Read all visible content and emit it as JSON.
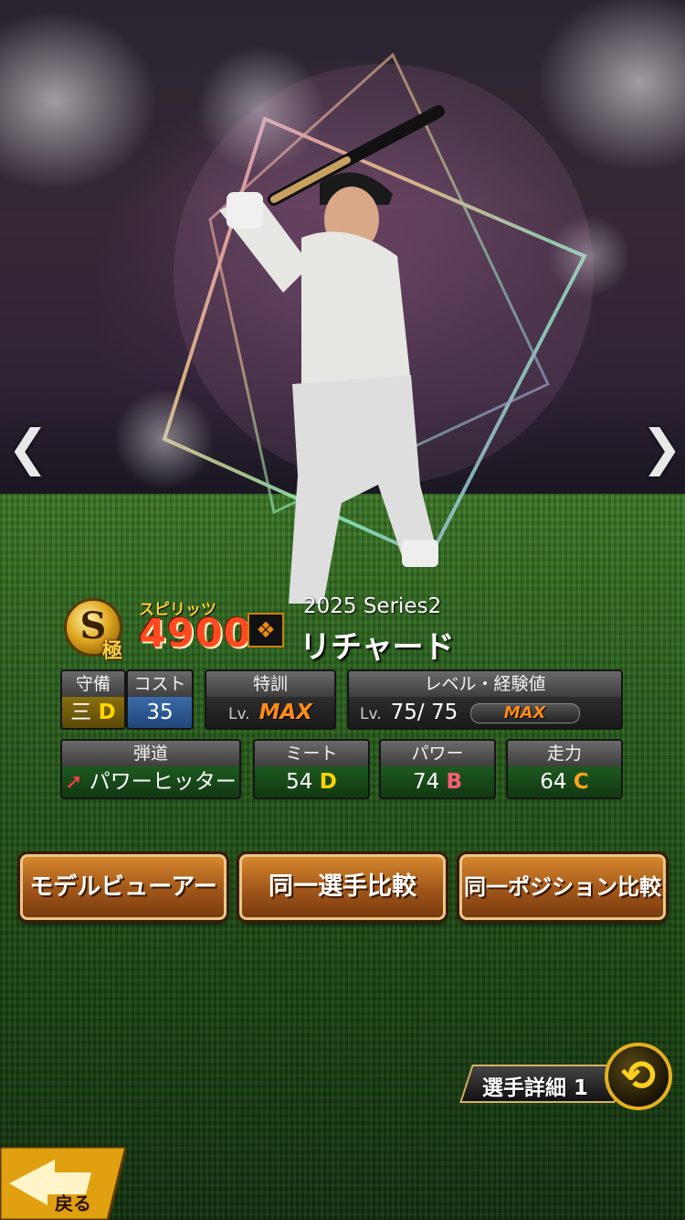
{
  "nav": {
    "prev_icon": "chevron-left",
    "next_icon": "chevron-right",
    "prev_glyph": "❮",
    "next_glyph": "❯"
  },
  "header": {
    "rank_letter": "S",
    "rank_sub": "極",
    "spirits_label": "スピリッツ",
    "spirits_value": "4900",
    "team_logo_glyph": "❖",
    "series": "2025 Series2",
    "player_name": "リチャード"
  },
  "stats": {
    "position": {
      "label": "守備",
      "value": "三",
      "grade": "D"
    },
    "cost": {
      "label": "コスト",
      "value": "35"
    },
    "training": {
      "label": "特訓",
      "lv_prefix": "Lv.",
      "value": "MAX"
    },
    "level": {
      "label": "レベル・経験値",
      "lv_prefix": "Lv.",
      "current": "75",
      "separator": "/",
      "max": "75",
      "exp": "MAX"
    },
    "trajectory": {
      "label": "弾道",
      "value": "パワーヒッター",
      "arrow": "➚"
    },
    "contact": {
      "label": "ミート",
      "value": "54",
      "grade": "D"
    },
    "power": {
      "label": "パワー",
      "value": "74",
      "grade": "B"
    },
    "speed": {
      "label": "走力",
      "value": "64",
      "grade": "C"
    }
  },
  "buttons": {
    "model_viewer": "モデルビューアー",
    "same_player_compare": "同一選手比較",
    "same_position_compare": "同一ポジション比較"
  },
  "footer": {
    "detail_label": "選手詳細 1",
    "swap_glyph": "⟲",
    "back_label": "戻る"
  },
  "colors": {
    "accent_gold": "#e4b020",
    "button_orange": "#c0702a",
    "field_green": "#2d6420"
  }
}
